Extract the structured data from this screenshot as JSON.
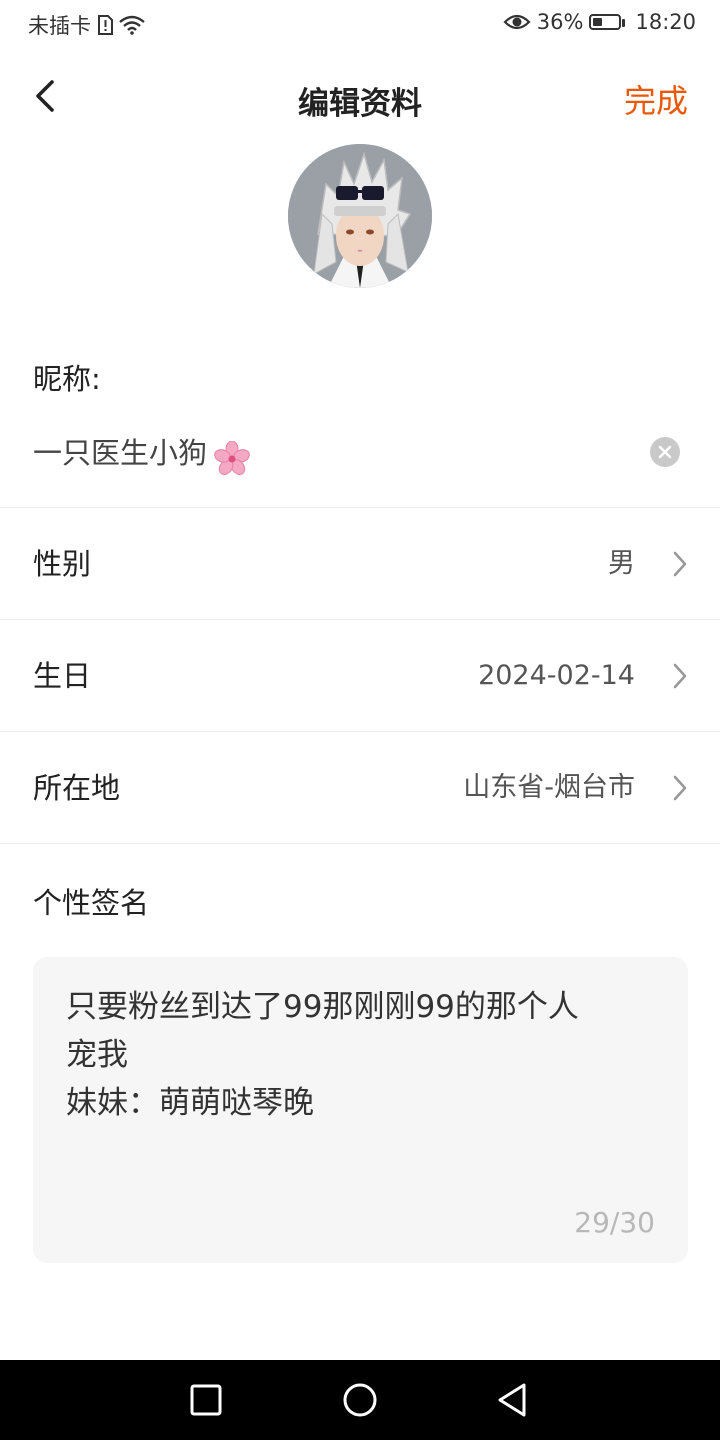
{
  "status_bar": {
    "carrier": "未插卡",
    "battery_percent": "36%",
    "battery_level": 0.36,
    "time": "18:20"
  },
  "header": {
    "title": "编辑资料",
    "done_label": "完成",
    "accent_color": "#e8590c"
  },
  "nickname": {
    "label": "昵称:",
    "value": "一只医生小狗"
  },
  "rows": [
    {
      "label": "性别",
      "value": "男"
    },
    {
      "label": "生日",
      "value": "2024-02-14"
    },
    {
      "label": "所在地",
      "value": "山东省-烟台市"
    }
  ],
  "signature": {
    "label": "个性签名",
    "text": "只要粉丝到达了99那刚刚99的那个人\n宠我\n妹妹：萌萌哒琴晚",
    "counter": "29/30"
  },
  "nav_icons": [
    "recent-apps-icon",
    "home-icon",
    "back-icon"
  ]
}
